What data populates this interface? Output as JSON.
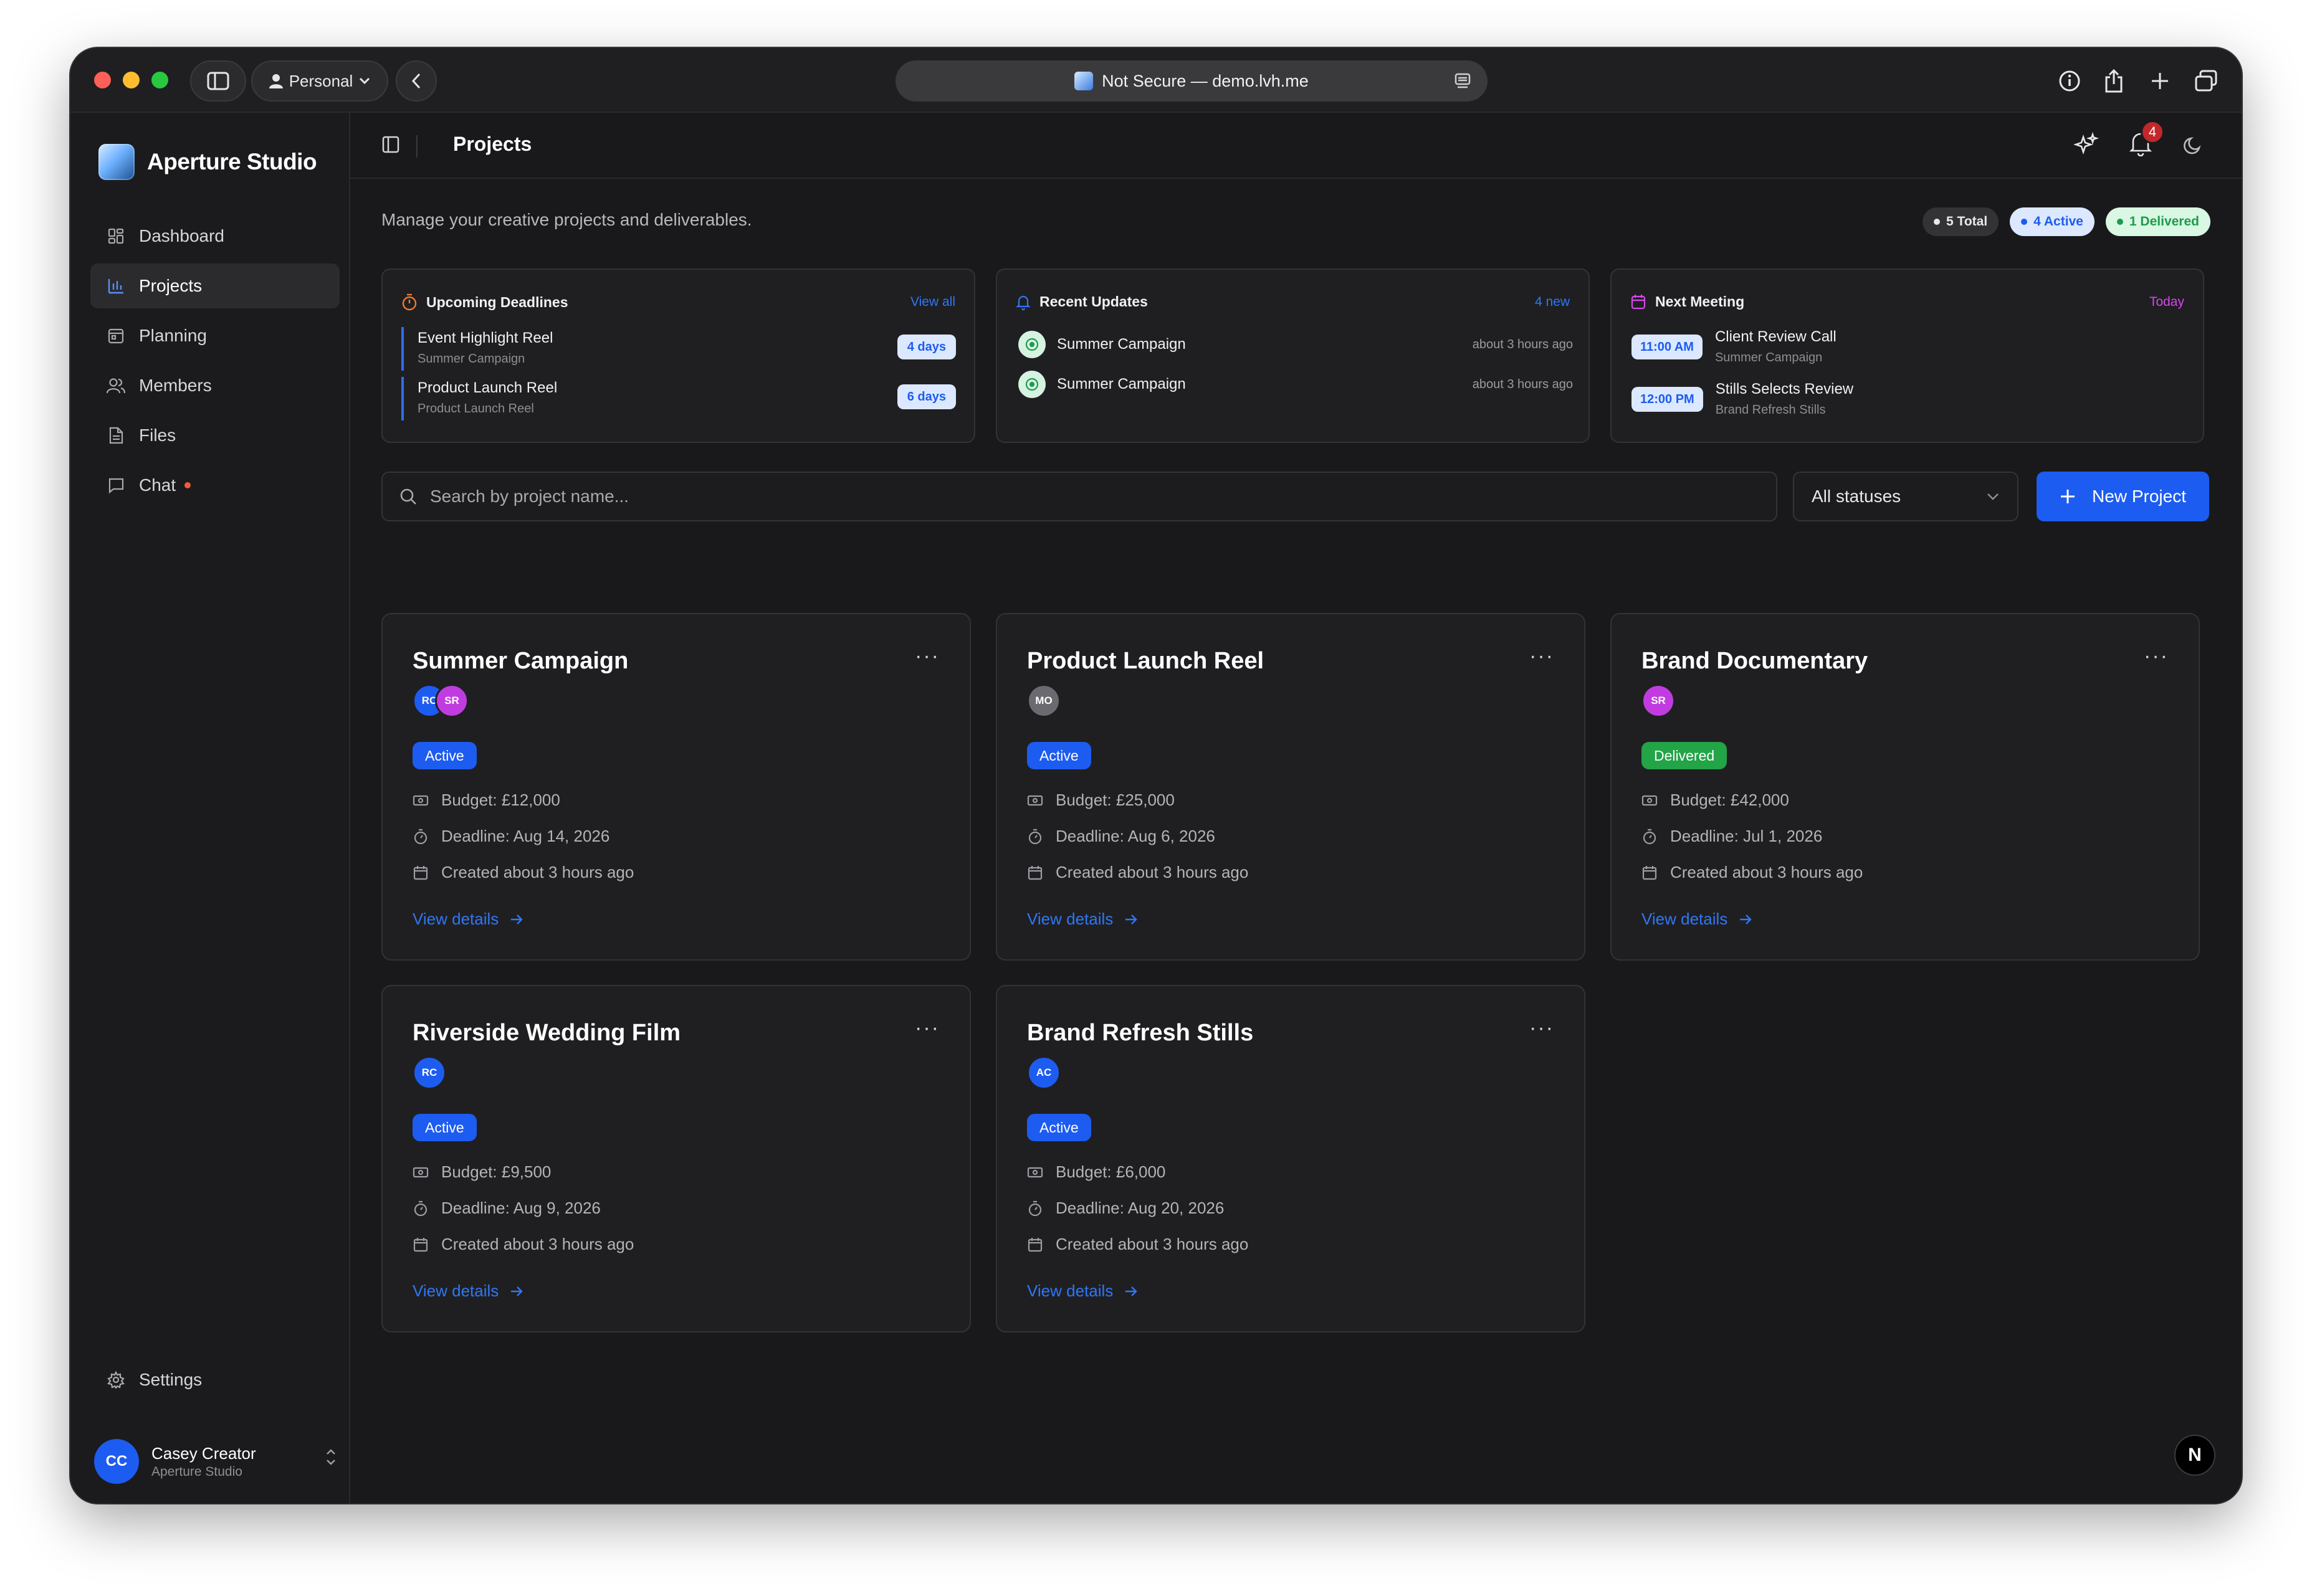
{
  "browser": {
    "profile_label": "Personal",
    "address": "Not Secure — demo.lvh.me"
  },
  "app": {
    "name": "Aperture Studio",
    "nav": [
      {
        "label": "Dashboard",
        "icon": "grid-icon"
      },
      {
        "label": "Projects",
        "icon": "bar-chart-icon",
        "active": true
      },
      {
        "label": "Planning",
        "icon": "calendar-icon"
      },
      {
        "label": "Members",
        "icon": "users-icon"
      },
      {
        "label": "Files",
        "icon": "file-icon"
      },
      {
        "label": "Chat",
        "icon": "chat-icon",
        "has_dot": true
      }
    ],
    "settings_label": "Settings",
    "user": {
      "initials": "CC",
      "name": "Casey Creator",
      "org": "Aperture Studio"
    }
  },
  "header": {
    "title": "Projects",
    "notification_count": "4"
  },
  "summary": {
    "subtitle": "Manage your creative projects and deliverables.",
    "total": "5 Total",
    "active": "4 Active",
    "delivered": "1 Delivered"
  },
  "panels": {
    "deadlines": {
      "title": "Upcoming Deadlines",
      "link": "View all",
      "items": [
        {
          "title": "Event Highlight Reel",
          "sub": "Summer Campaign",
          "badge": "4 days"
        },
        {
          "title": "Product Launch Reel",
          "sub": "Product Launch Reel",
          "badge": "6 days"
        }
      ]
    },
    "updates": {
      "title": "Recent Updates",
      "link": "4 new",
      "items": [
        {
          "title": "Summer Campaign",
          "time": "about 3 hours ago"
        },
        {
          "title": "Summer Campaign",
          "time": "about 3 hours ago"
        }
      ]
    },
    "meeting": {
      "title": "Next Meeting",
      "link": "Today",
      "items": [
        {
          "time": "11:00 AM",
          "title": "Client Review Call",
          "sub": "Summer Campaign"
        },
        {
          "time": "12:00 PM",
          "title": "Stills Selects Review",
          "sub": "Brand Refresh Stills"
        }
      ]
    }
  },
  "toolbar": {
    "search_placeholder": "Search by project name...",
    "status_filter": "All statuses",
    "new_button": "New Project"
  },
  "projects": [
    {
      "title": "Summer Campaign",
      "avatars": [
        {
          "initials": "RC",
          "color": "#1d5cf0"
        },
        {
          "initials": "SR",
          "color": "#c13ce0"
        }
      ],
      "status": "Active",
      "budget": "Budget: £12,000",
      "deadline": "Deadline: Aug 14, 2026",
      "created": "Created about 3 hours ago",
      "link": "View details"
    },
    {
      "title": "Product Launch Reel",
      "avatars": [
        {
          "initials": "MO",
          "color": "#6a6a70"
        }
      ],
      "status": "Active",
      "budget": "Budget: £25,000",
      "deadline": "Deadline: Aug 6, 2026",
      "created": "Created about 3 hours ago",
      "link": "View details"
    },
    {
      "title": "Brand Documentary",
      "avatars": [
        {
          "initials": "SR",
          "color": "#c13ce0"
        }
      ],
      "status": "Delivered",
      "budget": "Budget: £42,000",
      "deadline": "Deadline: Jul 1, 2026",
      "created": "Created about 3 hours ago",
      "link": "View details"
    },
    {
      "title": "Riverside Wedding Film",
      "avatars": [
        {
          "initials": "RC",
          "color": "#1d5cf0"
        }
      ],
      "status": "Active",
      "budget": "Budget: £9,500",
      "deadline": "Deadline: Aug 9, 2026",
      "created": "Created about 3 hours ago",
      "link": "View details"
    },
    {
      "title": "Brand Refresh Stills",
      "avatars": [
        {
          "initials": "AC",
          "color": "#1d5cf0"
        }
      ],
      "status": "Active",
      "budget": "Budget: £6,000",
      "deadline": "Deadline: Aug 20, 2026",
      "created": "Created about 3 hours ago",
      "link": "View details"
    }
  ],
  "colors": {
    "accent": "#1d5cf0",
    "active_status": "#1d5cf0",
    "delivered_status": "#22a447",
    "deadline_icon": "#f07a2e",
    "meeting_icon": "#d946ef",
    "meeting_link": "#d946ef"
  },
  "floating": {
    "badge": "N"
  }
}
